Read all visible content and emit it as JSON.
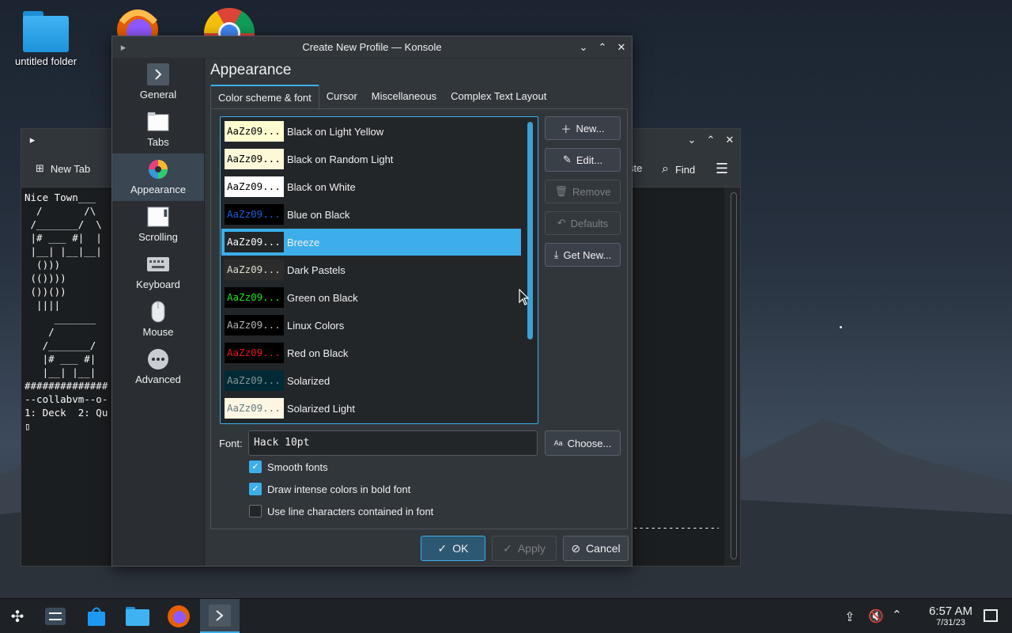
{
  "desktop": {
    "icons": [
      {
        "label": "untitled folder"
      }
    ]
  },
  "background_window": {
    "toolbar": {
      "new_tab": "New Tab",
      "paste_partial": "ste",
      "find": "Find"
    },
    "terminal_lines": [
      "Nice Town___",
      "  /       /\\",
      " /_______/  \\",
      " |# ___ #|  |",
      " |__| |__|__|",
      "",
      "",
      "",
      "",
      "",
      "  ()))",
      " (()))) ",
      " ())())",
      "  ||||",
      "",
      "",
      "",
      "     _______",
      "    /",
      "   /_______/",
      "   |# ___ #|",
      "   |__| |__|",
      "",
      "",
      "##############",
      "--collabvm--o-",
      "1: Deck  2: Qu",
      "▯"
    ],
    "terminal_rule": "------------------------------------------"
  },
  "dialog": {
    "title": "Create New Profile — Konsole",
    "sidebar": [
      {
        "label": "General",
        "icon": "terminal-icon"
      },
      {
        "label": "Tabs",
        "icon": "tabs-icon"
      },
      {
        "label": "Appearance",
        "icon": "color-wheel-icon"
      },
      {
        "label": "Scrolling",
        "icon": "scrolling-icon"
      },
      {
        "label": "Keyboard",
        "icon": "keyboard-icon"
      },
      {
        "label": "Mouse",
        "icon": "mouse-icon"
      },
      {
        "label": "Advanced",
        "icon": "more-icon"
      }
    ],
    "page_title": "Appearance",
    "tabs": [
      {
        "label": "Color scheme & font"
      },
      {
        "label": "Cursor"
      },
      {
        "label": "Miscellaneous"
      },
      {
        "label": "Complex Text Layout"
      }
    ],
    "color_schemes": [
      {
        "sample": "AaZz09...",
        "name": "Black on Light Yellow",
        "bg": "#fffdd0",
        "fg": "#000000"
      },
      {
        "sample": "AaZz09...",
        "name": "Black on Random Light",
        "bg": "#fdf8d8",
        "fg": "#000000"
      },
      {
        "sample": "AaZz09...",
        "name": "Black on White",
        "bg": "#ffffff",
        "fg": "#000000"
      },
      {
        "sample": "AaZz09...",
        "name": "Blue on Black",
        "bg": "#000000",
        "fg": "#1a5ed8"
      },
      {
        "sample": "AaZz09...",
        "name": "Breeze",
        "bg": "#232627",
        "fg": "#fcfcfc",
        "selected": true
      },
      {
        "sample": "AaZz09...",
        "name": "Dark Pastels",
        "bg": "#2c2c2c",
        "fg": "#dcdccc"
      },
      {
        "sample": "AaZz09...",
        "name": "Green on Black",
        "bg": "#000000",
        "fg": "#18e018"
      },
      {
        "sample": "AaZz09...",
        "name": "Linux Colors",
        "bg": "#000000",
        "fg": "#b2b2b2"
      },
      {
        "sample": "AaZz09...",
        "name": "Red on Black",
        "bg": "#000000",
        "fg": "#e01818"
      },
      {
        "sample": "AaZz09...",
        "name": "Solarized",
        "bg": "#002b36",
        "fg": "#839496"
      },
      {
        "sample": "AaZz09...",
        "name": "Solarized Light",
        "bg": "#fdf6e3",
        "fg": "#657b83"
      }
    ],
    "buttons": {
      "new": "New...",
      "edit": "Edit...",
      "remove": "Remove",
      "defaults": "Defaults",
      "get_new": "Get New...",
      "choose": "Choose...",
      "ok": "OK",
      "apply": "Apply",
      "cancel": "Cancel"
    },
    "font_label": "Font:",
    "font_value": "Hack 10pt",
    "checkboxes": [
      {
        "label": "Smooth fonts",
        "checked": true
      },
      {
        "label": "Draw intense colors in bold font",
        "checked": true
      },
      {
        "label": "Use line characters contained in font",
        "checked": false
      }
    ]
  },
  "taskbar": {
    "time": "6:57 AM",
    "date": "7/31/23"
  },
  "colors": {
    "accent": "#3daee9",
    "window_bg": "#31363b",
    "view_bg": "#232629"
  }
}
